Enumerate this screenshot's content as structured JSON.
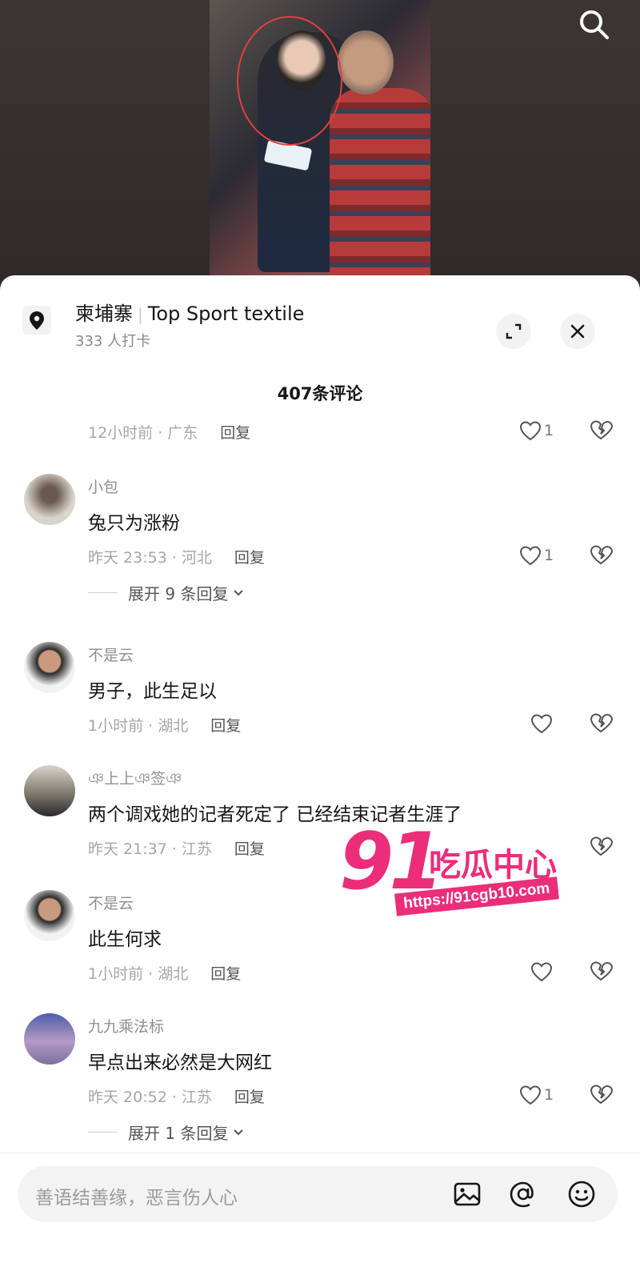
{
  "location": {
    "name": "柬埔寨",
    "place": "Top Sport textile",
    "checkins": "333 人打卡"
  },
  "comment_count": "407条评论",
  "top_partial": {
    "meta": "12小时前 · 广东",
    "reply": "回复",
    "likes": "1"
  },
  "comments": [
    {
      "user": "小包",
      "text": "兔只为涨粉",
      "meta": "昨天 23:53 · 河北",
      "reply": "回复",
      "likes": "1",
      "expand": "展开 9 条回复"
    },
    {
      "user": "不是云",
      "text": "男子，此生足以",
      "meta": "1小时前 · 湖北",
      "reply": "回复",
      "likes": ""
    },
    {
      "user": "ঞ上上ঞ签ঞ",
      "text": "两个调戏她的记者死定了 已经结束记者生涯了",
      "meta": "昨天 21:37 · 江苏",
      "reply": "回复",
      "likes": ""
    },
    {
      "user": "不是云",
      "text": "此生何求",
      "meta": "1小时前 · 湖北",
      "reply": "回复",
      "likes": ""
    },
    {
      "user": "九九乘法标",
      "text": "早点出来必然是大网红",
      "meta": "昨天 20:52 · 江苏",
      "reply": "回复",
      "likes": "1",
      "expand": "展开 1 条回复"
    }
  ],
  "watermark": {
    "number": "91",
    "brand": "吃瓜中心",
    "url": "https://91cgb10.com"
  },
  "input": {
    "placeholder": "善语结善缘，恶言伤人心"
  },
  "colors": {
    "accent": "#ec2d7a",
    "sheet": "#ffffff",
    "muted": "#a6a6a6"
  }
}
